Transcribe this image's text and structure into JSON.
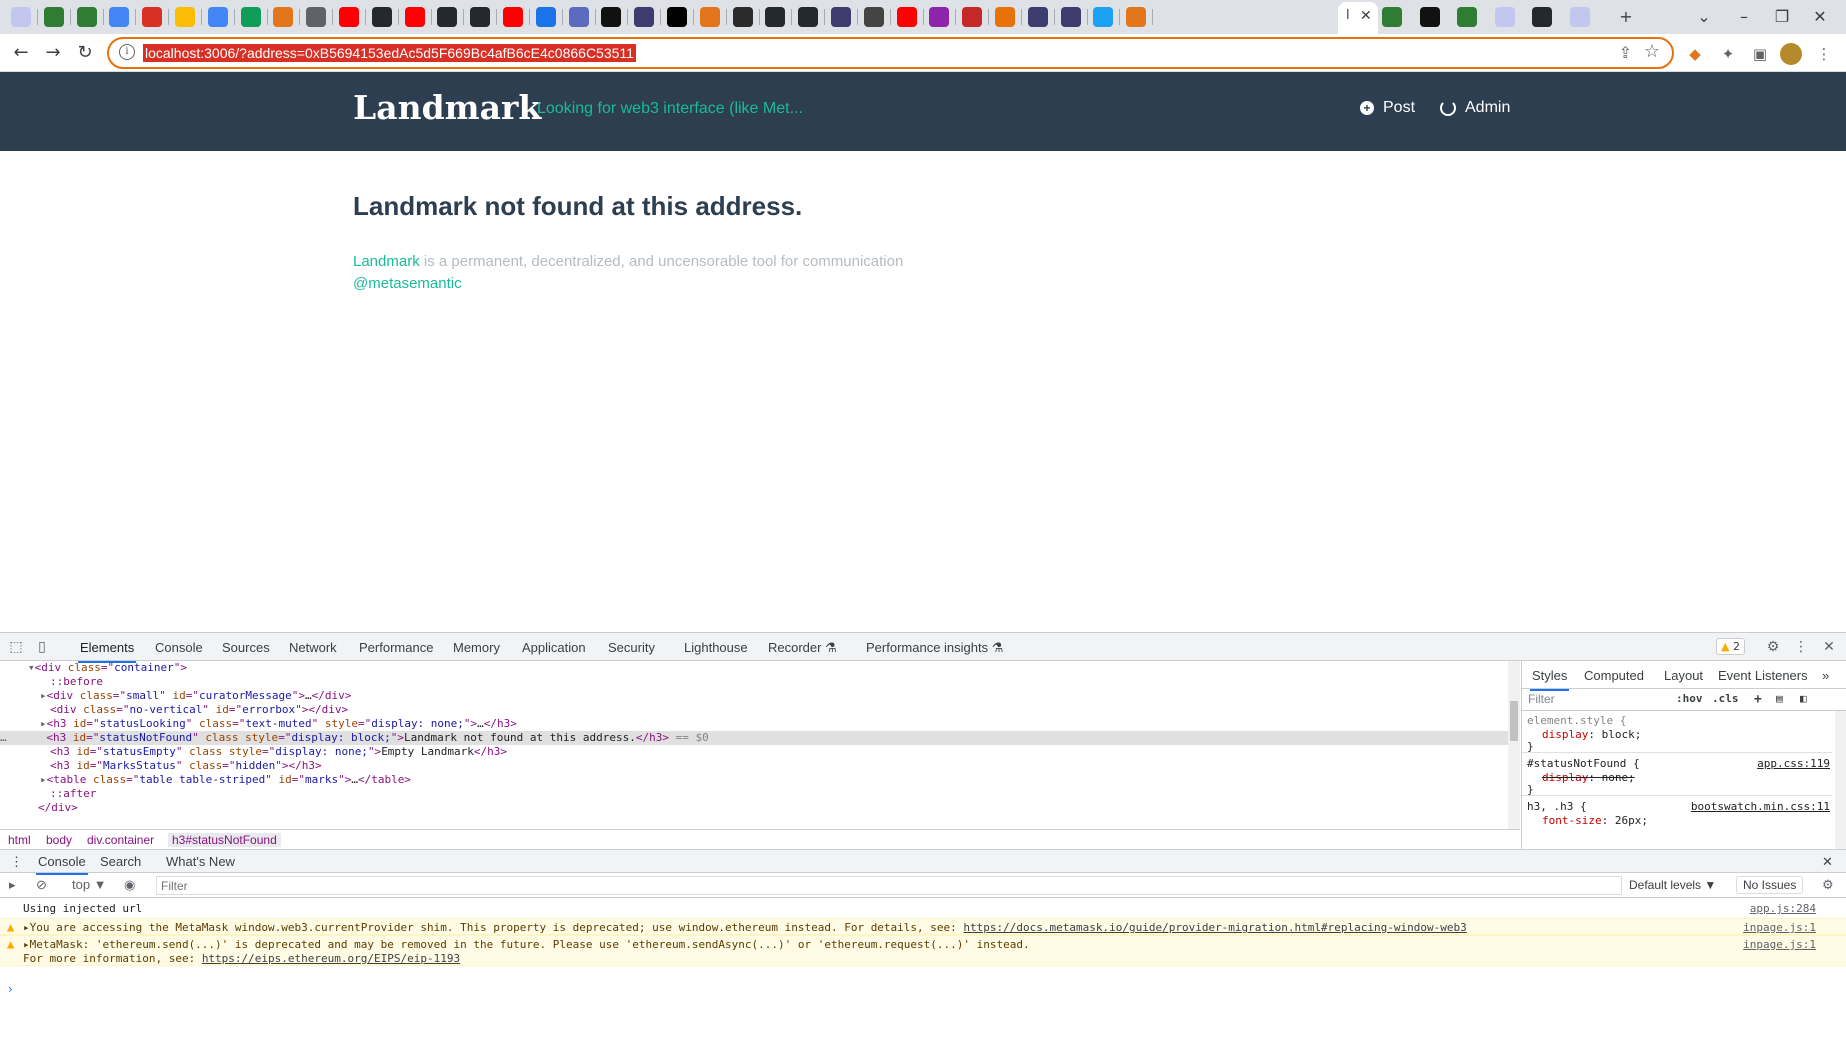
{
  "browser": {
    "active_tab_title": "l",
    "url": "localhost:3006/?address=0xB5694153edAc5d5F669Bc4afB6cE4c0866C53511"
  },
  "page": {
    "brand": "Landmark",
    "curator_message": "Looking for web3 interface (like Met...",
    "nav": {
      "post": "Post",
      "admin": "Admin"
    },
    "status": "Landmark not found at this address.",
    "footer_link": "Landmark",
    "footer_text": " is a permanent, decentralized, and uncensorable tool for communication",
    "handle": "@metasemantic"
  },
  "devtools": {
    "tabs": [
      "Elements",
      "Console",
      "Sources",
      "Network",
      "Performance",
      "Memory",
      "Application",
      "Security",
      "Lighthouse",
      "Recorder ⚗",
      "Performance insights ⚗"
    ],
    "warning_count": "2",
    "breadcrumb": [
      "html",
      "body",
      "div.container",
      "h3#statusNotFound"
    ],
    "styles_tabs": [
      "Styles",
      "Computed",
      "Layout",
      "Event Listeners"
    ],
    "styles_filter_placeholder": "Filter",
    "styles_buttons": [
      ":hov",
      ".cls"
    ],
    "rules": [
      {
        "selector": "element.style {",
        "source": "",
        "prop": "display",
        "value": "block;",
        "struck": false
      },
      {
        "selector": "#statusNotFound {",
        "source": "app.css:119",
        "prop": "display",
        "value": "none;",
        "struck": true
      },
      {
        "selector": "h3, .h3 {",
        "source": "bootswatch.min.css:11",
        "prop": "font-size",
        "value": "26px;",
        "struck": false
      }
    ],
    "drawer_tabs": [
      "Console",
      "Search",
      "What's New"
    ],
    "console": {
      "context": "top ▼",
      "filter_placeholder": "Filter",
      "levels": "Default levels ▼",
      "issues": "No Issues",
      "messages": [
        {
          "text": "Using injected url",
          "source": "app.js:284"
        },
        {
          "text": "▸You are accessing the MetaMask window.web3.currentProvider shim. This property is deprecated; use window.ethereum instead. For details, see: ",
          "link": "https://docs.metamask.io/guide/provider-migration.html#replacing-window-web3",
          "source": "inpage.js:1"
        },
        {
          "text": "▸MetaMask: 'ethereum.send(...)' is deprecated and may be removed in the future. Please use 'ethereum.sendAsync(...)' or 'ethereum.request(...)' instead.",
          "text2": "For more information, see: ",
          "link": "https://eips.ethereum.org/EIPS/eip-1193",
          "source": "inpage.js:1"
        }
      ]
    }
  },
  "colors": {
    "navbar": "#2c3e50",
    "accent": "#18bc9c",
    "omnibox_border": "#e8710a"
  }
}
